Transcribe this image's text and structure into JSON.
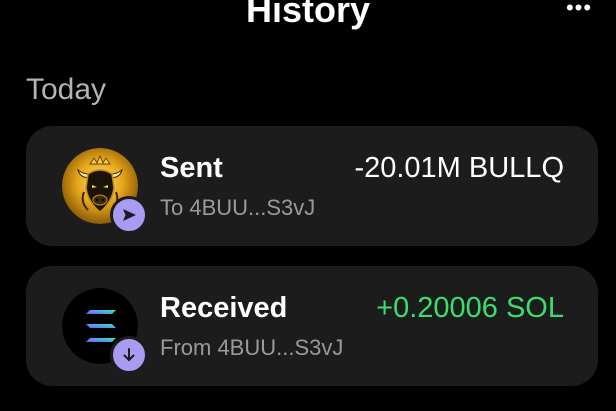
{
  "header": {
    "title": "History",
    "more_label": "•••"
  },
  "sections": [
    {
      "heading": "Today",
      "transactions": [
        {
          "type_label": "Sent",
          "counterparty": "To 4BUU...S3vJ",
          "amount": "-20.01M BULLQ",
          "token_icon": "bull-token-icon",
          "badge_icon": "send-arrow-icon"
        },
        {
          "type_label": "Received",
          "counterparty": "From 4BUU...S3vJ",
          "amount": "+0.20006 SOL",
          "token_icon": "solana-logo-icon",
          "badge_icon": "download-arrow-icon"
        }
      ]
    }
  ],
  "colors": {
    "background": "#000000",
    "card": "#1c1c1c",
    "badge": "#a89bf2",
    "positive": "#3ddc6e",
    "muted_text": "#9a9a9a",
    "section_heading": "#b3b3b3"
  }
}
